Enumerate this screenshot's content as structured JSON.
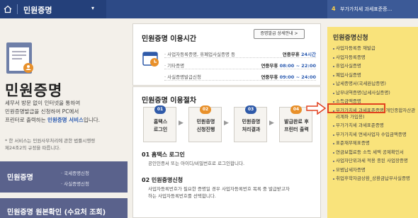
{
  "topbar": {
    "title": "민원증명",
    "caret": "▾",
    "right_num": "4",
    "right_text": "부가가치세 과세표준증..."
  },
  "left": {
    "big_title": "민원증명",
    "intro_1": "세무서 방문 없이 인터넷을 통하여",
    "intro_2": "민원증명발급을 신청하여 PC에서",
    "intro_3a": "프린터로 출력하는 ",
    "intro_3b": "민원증명 서비스",
    "intro_3c": "입니다.",
    "note_1": "* 한 서비스는 민원사무처리에 관한 법률시행령",
    "note_2": "제24조2의 규정을 따릅니다.",
    "menu1_title": "민원증명",
    "menu1_link1": "· 국세증명신청",
    "menu1_link2": "· 사실증명신청",
    "menu2_title": "민원증명 원본확인 (수요처 조회)"
  },
  "hours": {
    "title": "민원증명 이용시간",
    "detail_button": "증명발급 상세안내 >",
    "rows": [
      {
        "label": "· 사업자등록증명, 휴폐업사실증명 등",
        "prefix": "연중무휴 ",
        "value": "24시간"
      },
      {
        "label": "· 기타증명",
        "prefix": "연중무휴 ",
        "value": "08:00 ~ 22:00"
      },
      {
        "label": "· 사실증명발급신청",
        "prefix": "연중무휴 ",
        "value": "09:00 ~ 24:00"
      }
    ]
  },
  "procedure": {
    "title": "민원증명 이용절차",
    "steps": [
      {
        "num": "01",
        "line1": "홈택스",
        "line2": "로그인"
      },
      {
        "num": "02",
        "line1": "민원증명",
        "line2": "신청진행"
      },
      {
        "num": "03",
        "line1": "민원증명",
        "line2": "처리결과"
      },
      {
        "num": "04",
        "line1": "발급완료 후",
        "line2": "프린터 출력"
      }
    ],
    "arrow": "▶",
    "sec1_title": "01 홈택스 로그인",
    "sec1_text": "공인인증서 또는 아이디/비밀번호로 로그인합니다.",
    "sec2_title": "02 민원증명신청",
    "sec2_text_1": "사업자등록번호가 필요한 증명일 경우 사업자등록번호 목록 중 발급받고자",
    "sec2_text_2": "하는 사업자등록번호를 선택합니다."
  },
  "apply": {
    "title": "민원증명신청",
    "items": [
      "사업자등록증 재발급",
      "사업자등록증명",
      "휴업사실증명",
      "폐업사실증명",
      "납세증명서(국세완납증명)",
      "납부내역증명(납세사실증명)",
      "소득금액증명",
      "부가가치세 과세표준증명(개인종합자산관리계좌 가입용)",
      "부가가치세 과세표준증명",
      "부가가치세 면세사업자 수입금액증명",
      "표준재무제표증명",
      "연금보험료등 소득 세액 공제확인서",
      "사업자단위과세 적용 종된 사업장증명",
      "모범납세자증명",
      "취업후학자금상환_상환금납부사실증명"
    ]
  },
  "colors": {
    "topbar": "#2d4a86",
    "accent_yellow": "#f9e37b",
    "highlight_red": "#e2411f",
    "badge_blue": "#2f5aa9",
    "badge_orange": "#e8902a"
  }
}
